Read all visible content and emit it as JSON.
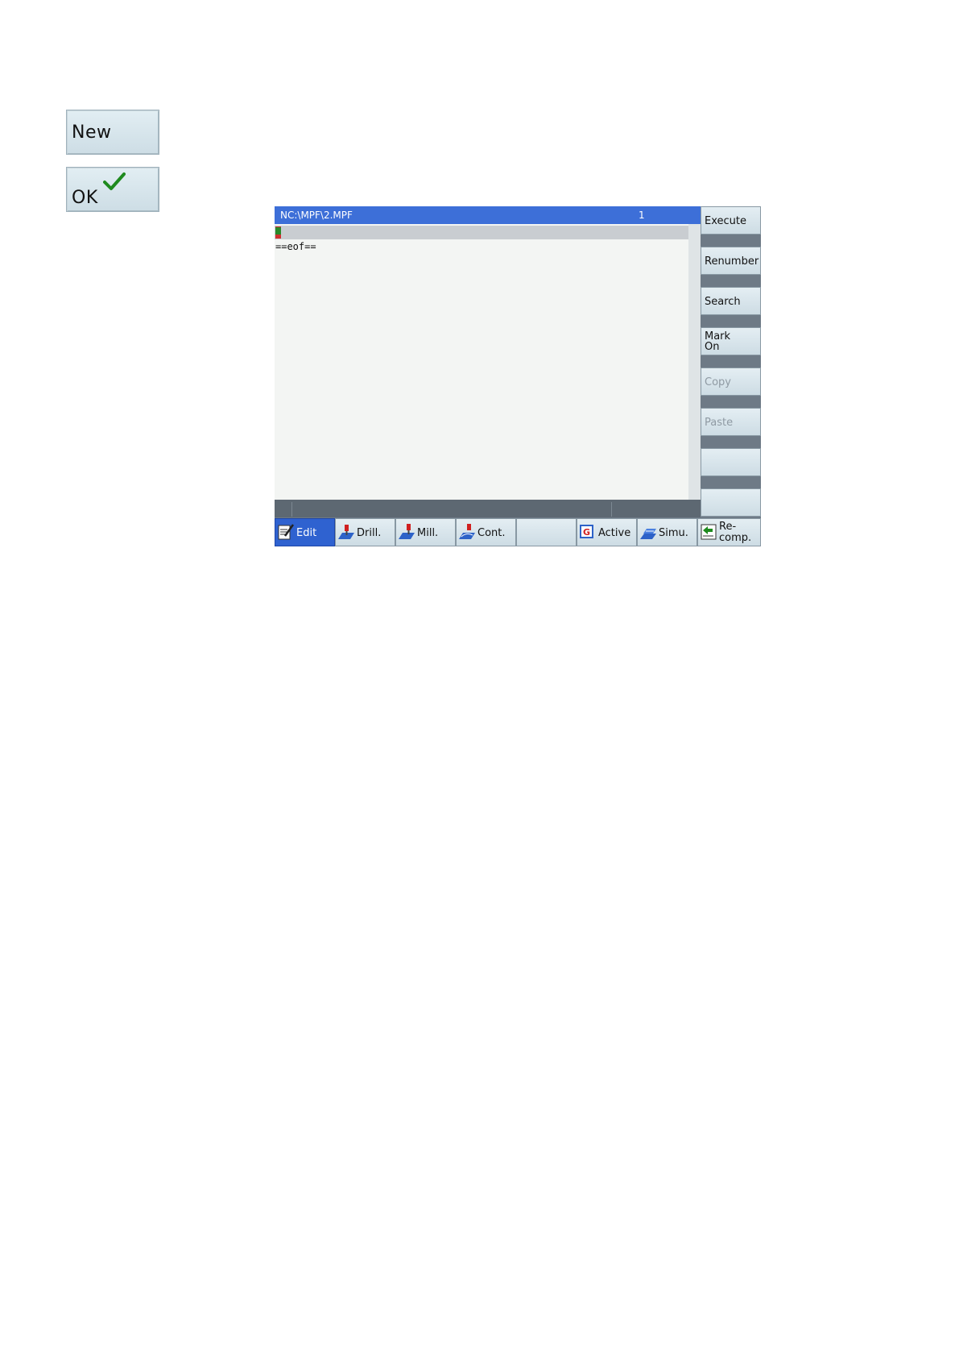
{
  "side_keys": {
    "new_label": "New",
    "ok_label": "OK"
  },
  "editor": {
    "file_path": "NC:\\MPF\\2.MPF",
    "line_number": "1",
    "eof_text": "==eof=="
  },
  "vertical_softkeys": [
    {
      "label": "Execute",
      "enabled": true
    },
    {
      "label": "Renumber",
      "enabled": true
    },
    {
      "label": "Search",
      "enabled": true
    },
    {
      "label": "Mark On",
      "line1": "Mark",
      "line2": "On",
      "enabled": true
    },
    {
      "label": "Copy",
      "enabled": false
    },
    {
      "label": "Paste",
      "enabled": false
    },
    {
      "label": "",
      "enabled": true
    },
    {
      "label": "",
      "enabled": true
    }
  ],
  "horizontal_softkeys": [
    {
      "label": "Edit",
      "icon": "edit-icon",
      "active": true
    },
    {
      "label": "Drill.",
      "icon": "drill-icon"
    },
    {
      "label": "Mill.",
      "icon": "mill-icon"
    },
    {
      "label": "Cont.",
      "icon": "contour-icon"
    },
    {
      "label": "",
      "icon": ""
    },
    {
      "label": "Active",
      "icon": "g-code-icon"
    },
    {
      "label": "Simu.",
      "icon": "simulation-icon"
    },
    {
      "label": "Re-comp.",
      "line1": "Re-",
      "line2": "comp.",
      "icon": "recompile-icon"
    }
  ],
  "colors": {
    "title_bar": "#3d6fd8",
    "active_softkey": "#2f62d0",
    "checkmark": "#1e8a1e"
  }
}
